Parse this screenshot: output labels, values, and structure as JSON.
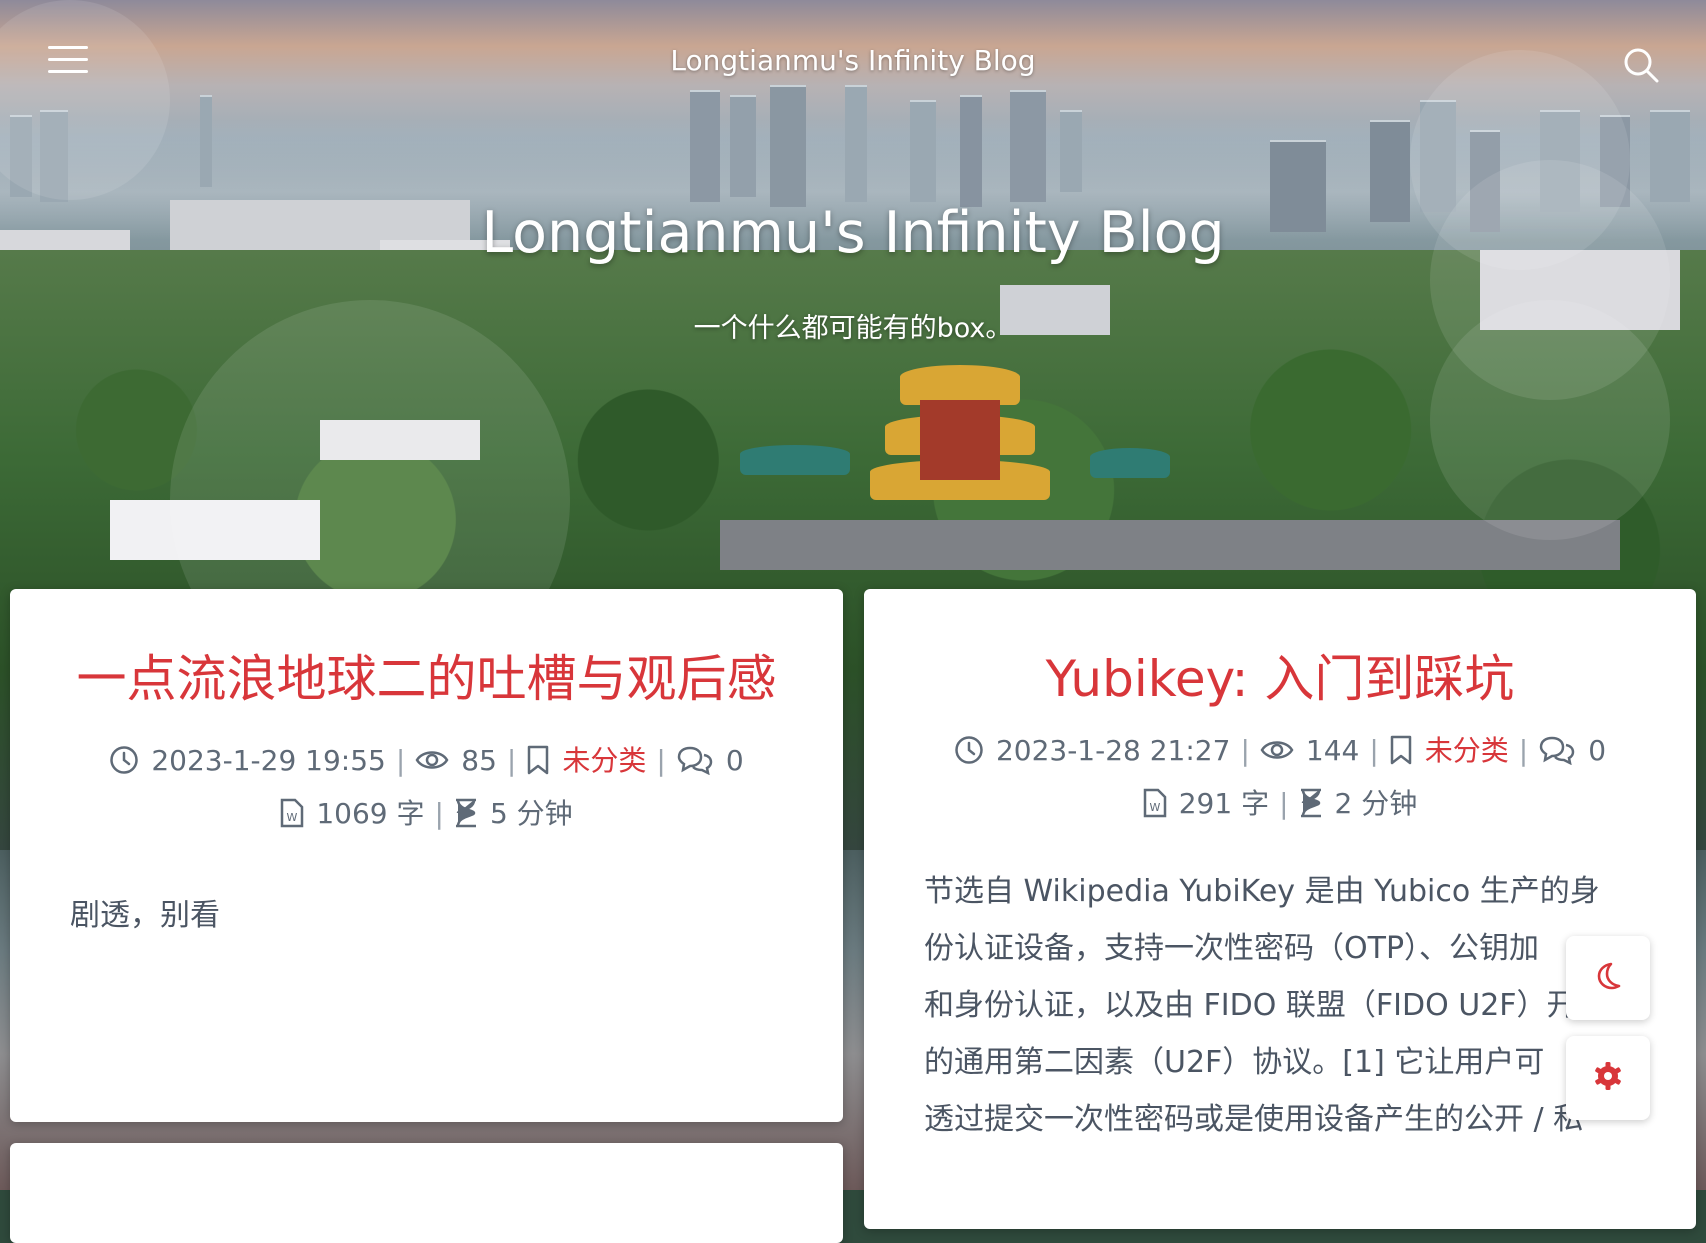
{
  "header": {
    "site_name": "Longtianmu's Infinity Blog",
    "hero_title": "Longtianmu's Infinity Blog",
    "hero_subtitle": "一个什么都可能有的box。"
  },
  "icons": {
    "menu": "menu-icon",
    "search": "search-icon",
    "clock": "clock-icon",
    "eye": "eye-icon",
    "bookmark": "bookmark-icon",
    "comment": "comment-icon",
    "word_file": "word-file-icon",
    "hourglass": "hourglass-icon",
    "moon": "moon-icon",
    "gear": "gear-icon"
  },
  "colors": {
    "accent": "#d8363a",
    "meta_text": "#5f6a77",
    "card_bg": "#ffffff"
  },
  "posts": [
    {
      "title": "一点流浪地球二的吐槽与观后感",
      "date": "2023-1-29 19:55",
      "views": "85",
      "category": "未分类",
      "comments": "0",
      "words": "1069 字",
      "read_time": "5 分钟",
      "excerpt": "剧透，别看"
    },
    {
      "title": "Yubikey: 入门到踩坑",
      "date": "2023-1-28 21:27",
      "views": "144",
      "category": "未分类",
      "comments": "0",
      "words": "291 字",
      "read_time": "2 分钟",
      "excerpt_lines": [
        "节选自 Wikipedia YubiKey 是由 Yubico 生产的身",
        "份认证设备，支持一次性密码（OTP）、公钥加",
        "和身份认证，以及由 FIDO 联盟（FIDO U2F）开发",
        "的通用第二因素（U2F）协议。[1] 它让用户可",
        "透过提交一次性密码或是使用设备产生的公开 / 私"
      ]
    }
  ]
}
